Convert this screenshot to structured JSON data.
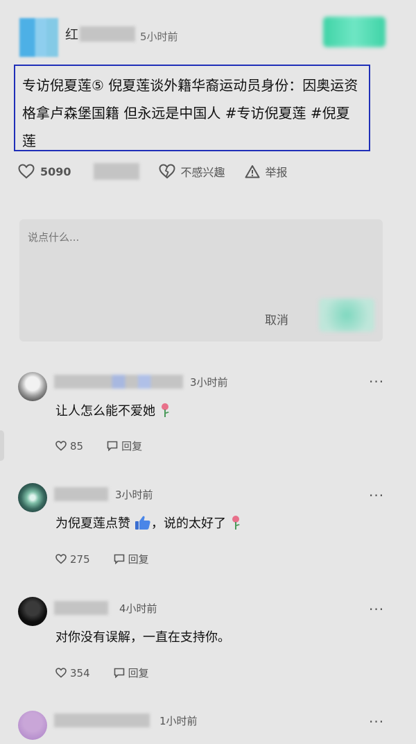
{
  "post": {
    "timestamp": "5小时前",
    "username_visible": "红",
    "text": "专访倪夏莲⑤ 倪夏莲谈外籍华裔运动员身份：因奥运资格拿卢森堡国籍 但永远是中国人 #专访倪夏莲 #倪夏莲",
    "likes": "5090",
    "dislike_label": "不感兴趣",
    "report_label": "举报"
  },
  "comment_box": {
    "placeholder": "说点什么...",
    "cancel_label": "取消"
  },
  "comments": [
    {
      "time": "3小时前",
      "text": "让人怎么能不爱她",
      "likes": "85",
      "reply_label": "回复"
    },
    {
      "time": "3小时前",
      "text": "为倪夏莲点赞",
      "text_tail": "，说的太好了",
      "likes": "275",
      "reply_label": "回复"
    },
    {
      "time": "4小时前",
      "text": "对你没有误解，一直在支持你。",
      "likes": "354",
      "reply_label": "回复"
    },
    {
      "time": "1小时前",
      "text": "",
      "likes": "",
      "reply_label": ""
    }
  ],
  "more_label": "···",
  "icons": [
    "heart-icon",
    "broken-heart-icon",
    "warning-icon",
    "comment-icon",
    "rose-icon",
    "thumbs-up-icon"
  ],
  "colors": {
    "highlight_border": "#1f2fb8",
    "background": "#e6e6e6",
    "follow_button": "#3fd3a6"
  }
}
